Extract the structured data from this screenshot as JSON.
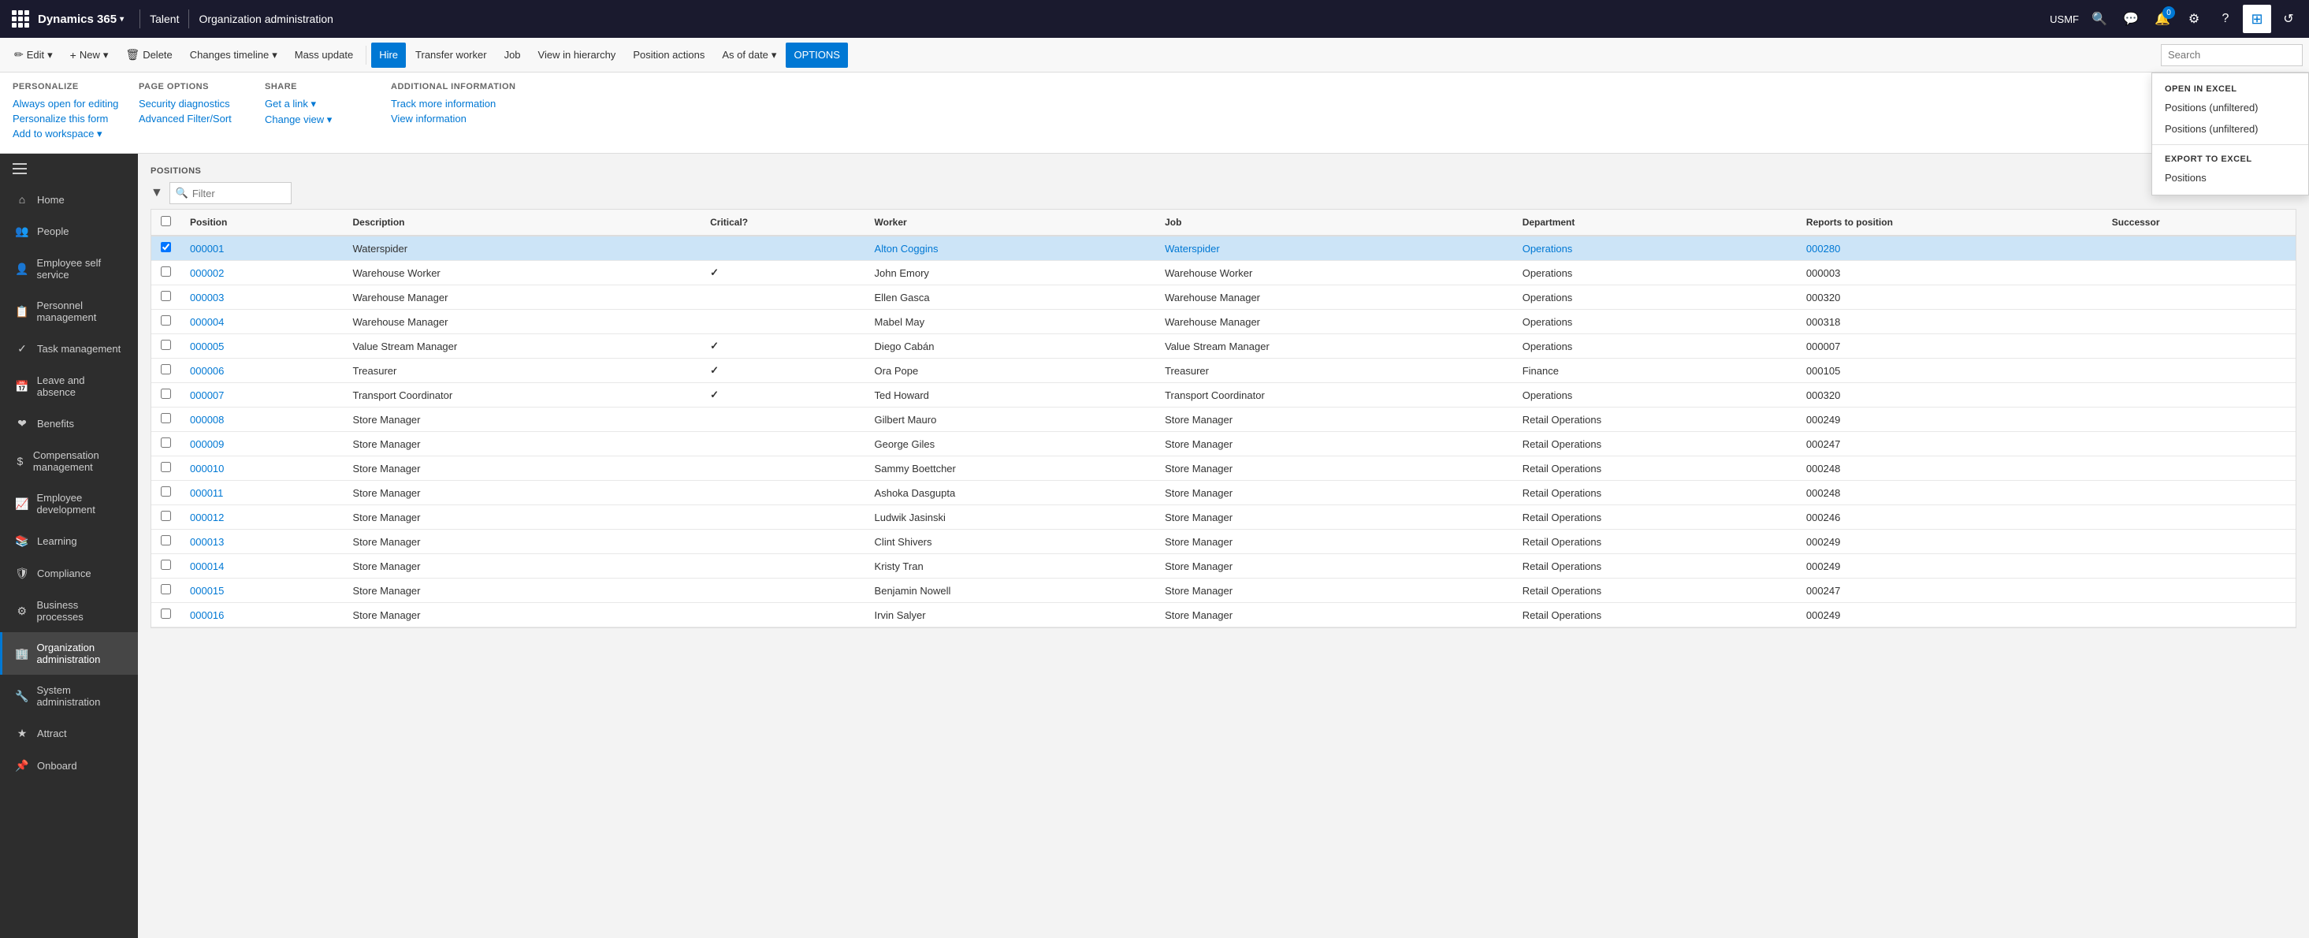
{
  "topNav": {
    "appName": "Dynamics 365",
    "moduleTitle": "Talent",
    "breadcrumb": "Organization administration",
    "userLabel": "USMF"
  },
  "toolbar": {
    "buttons": [
      {
        "label": "Edit",
        "icon": "✏️",
        "hasDropdown": true
      },
      {
        "label": "New",
        "icon": "+",
        "hasDropdown": true
      },
      {
        "label": "Delete",
        "icon": "🗑",
        "hasDropdown": false
      },
      {
        "label": "Changes timeline",
        "icon": "📋",
        "hasDropdown": true
      },
      {
        "label": "Mass update",
        "icon": "",
        "hasDropdown": false
      },
      {
        "label": "Hire",
        "icon": "",
        "hasDropdown": false,
        "active": false,
        "highlight": true
      },
      {
        "label": "Transfer worker",
        "icon": "",
        "hasDropdown": false
      },
      {
        "label": "Job",
        "icon": "",
        "hasDropdown": false
      },
      {
        "label": "View in hierarchy",
        "icon": "",
        "hasDropdown": false
      },
      {
        "label": "Position actions",
        "icon": "",
        "hasDropdown": false
      },
      {
        "label": "As of date",
        "icon": "",
        "hasDropdown": true
      },
      {
        "label": "OPTIONS",
        "icon": "",
        "hasDropdown": false,
        "active": true
      }
    ]
  },
  "optionsPanel": {
    "groups": [
      {
        "title": "PERSONALIZE",
        "links": [
          "Always open for editing",
          "Personalize this form",
          "Add to workspace ▾"
        ]
      },
      {
        "title": "PAGE OPTIONS",
        "links": [
          "Security diagnostics",
          "Advanced Filter/Sort"
        ]
      },
      {
        "title": "SHARE",
        "links": [
          "Get a link ▾"
        ]
      },
      {
        "title": "ADDITIONAL INFORMATION",
        "links": [
          "Track more information",
          "View information"
        ]
      }
    ]
  },
  "optionsDropdown": {
    "sections": [
      {
        "title": "OPEN IN EXCEL",
        "items": [
          "Positions (unfiltered)",
          "Positions (unfiltered)"
        ]
      },
      {
        "title": "EXPORT TO EXCEL",
        "items": [
          "Positions"
        ]
      }
    ]
  },
  "sidebar": {
    "hamburger": true,
    "items": [
      {
        "label": "Home",
        "icon": "⌂",
        "active": false
      },
      {
        "label": "People",
        "icon": "👥",
        "active": false
      },
      {
        "label": "Employee self service",
        "icon": "👤",
        "active": false
      },
      {
        "label": "Personnel management",
        "icon": "📋",
        "active": false
      },
      {
        "label": "Task management",
        "icon": "✓",
        "active": false
      },
      {
        "label": "Leave and absence",
        "icon": "📅",
        "active": false
      },
      {
        "label": "Benefits",
        "icon": "❤",
        "active": false
      },
      {
        "label": "Compensation management",
        "icon": "💲",
        "active": false
      },
      {
        "label": "Employee development",
        "icon": "📈",
        "active": false
      },
      {
        "label": "Learning",
        "icon": "📚",
        "active": false
      },
      {
        "label": "Compliance",
        "icon": "🛡",
        "active": false
      },
      {
        "label": "Business processes",
        "icon": "⚙",
        "active": false
      },
      {
        "label": "Organization administration",
        "icon": "🏢",
        "active": true
      },
      {
        "label": "System administration",
        "icon": "🔧",
        "active": false
      },
      {
        "label": "Attract",
        "icon": "★",
        "active": false
      },
      {
        "label": "Onboard",
        "icon": "📌",
        "active": false
      }
    ]
  },
  "positions": {
    "sectionLabel": "POSITIONS",
    "filterPlaceholder": "Filter",
    "columns": [
      "",
      "Position",
      "Description",
      "Critical?",
      "Worker",
      "Job",
      "Department",
      "Reports to position",
      "Successor"
    ],
    "rows": [
      {
        "position": "000001",
        "description": "Waterspider",
        "critical": false,
        "worker": "Alton Coggins",
        "job": "Waterspider",
        "department": "Operations",
        "reportsTo": "000280",
        "successor": "",
        "selected": true
      },
      {
        "position": "000002",
        "description": "Warehouse Worker",
        "critical": true,
        "worker": "John Emory",
        "job": "Warehouse Worker",
        "department": "Operations",
        "reportsTo": "000003",
        "successor": ""
      },
      {
        "position": "000003",
        "description": "Warehouse Manager",
        "critical": false,
        "worker": "Ellen Gasca",
        "job": "Warehouse Manager",
        "department": "Operations",
        "reportsTo": "000320",
        "successor": ""
      },
      {
        "position": "000004",
        "description": "Warehouse Manager",
        "critical": false,
        "worker": "Mabel May",
        "job": "Warehouse Manager",
        "department": "Operations",
        "reportsTo": "000318",
        "successor": ""
      },
      {
        "position": "000005",
        "description": "Value Stream Manager",
        "critical": true,
        "worker": "Diego Cabán",
        "job": "Value Stream Manager",
        "department": "Operations",
        "reportsTo": "000007",
        "successor": ""
      },
      {
        "position": "000006",
        "description": "Treasurer",
        "critical": true,
        "worker": "Ora Pope",
        "job": "Treasurer",
        "department": "Finance",
        "reportsTo": "000105",
        "successor": ""
      },
      {
        "position": "000007",
        "description": "Transport Coordinator",
        "critical": true,
        "worker": "Ted Howard",
        "job": "Transport Coordinator",
        "department": "Operations",
        "reportsTo": "000320",
        "successor": ""
      },
      {
        "position": "000008",
        "description": "Store Manager",
        "critical": false,
        "worker": "Gilbert Mauro",
        "job": "Store Manager",
        "department": "Retail Operations",
        "reportsTo": "000249",
        "successor": ""
      },
      {
        "position": "000009",
        "description": "Store Manager",
        "critical": false,
        "worker": "George Giles",
        "job": "Store Manager",
        "department": "Retail Operations",
        "reportsTo": "000247",
        "successor": ""
      },
      {
        "position": "000010",
        "description": "Store Manager",
        "critical": false,
        "worker": "Sammy Boettcher",
        "job": "Store Manager",
        "department": "Retail Operations",
        "reportsTo": "000248",
        "successor": ""
      },
      {
        "position": "000011",
        "description": "Store Manager",
        "critical": false,
        "worker": "Ashoka Dasgupta",
        "job": "Store Manager",
        "department": "Retail Operations",
        "reportsTo": "000248",
        "successor": ""
      },
      {
        "position": "000012",
        "description": "Store Manager",
        "critical": false,
        "worker": "Ludwik Jasinski",
        "job": "Store Manager",
        "department": "Retail Operations",
        "reportsTo": "000246",
        "successor": ""
      },
      {
        "position": "000013",
        "description": "Store Manager",
        "critical": false,
        "worker": "Clint Shivers",
        "job": "Store Manager",
        "department": "Retail Operations",
        "reportsTo": "000249",
        "successor": ""
      },
      {
        "position": "000014",
        "description": "Store Manager",
        "critical": false,
        "worker": "Kristy Tran",
        "job": "Store Manager",
        "department": "Retail Operations",
        "reportsTo": "000249",
        "successor": ""
      },
      {
        "position": "000015",
        "description": "Store Manager",
        "critical": false,
        "worker": "Benjamin Nowell",
        "job": "Store Manager",
        "department": "Retail Operations",
        "reportsTo": "000247",
        "successor": ""
      },
      {
        "position": "000016",
        "description": "Store Manager",
        "critical": false,
        "worker": "Irvin Salyer",
        "job": "Store Manager",
        "department": "Retail Operations",
        "reportsTo": "000249",
        "successor": ""
      }
    ]
  }
}
